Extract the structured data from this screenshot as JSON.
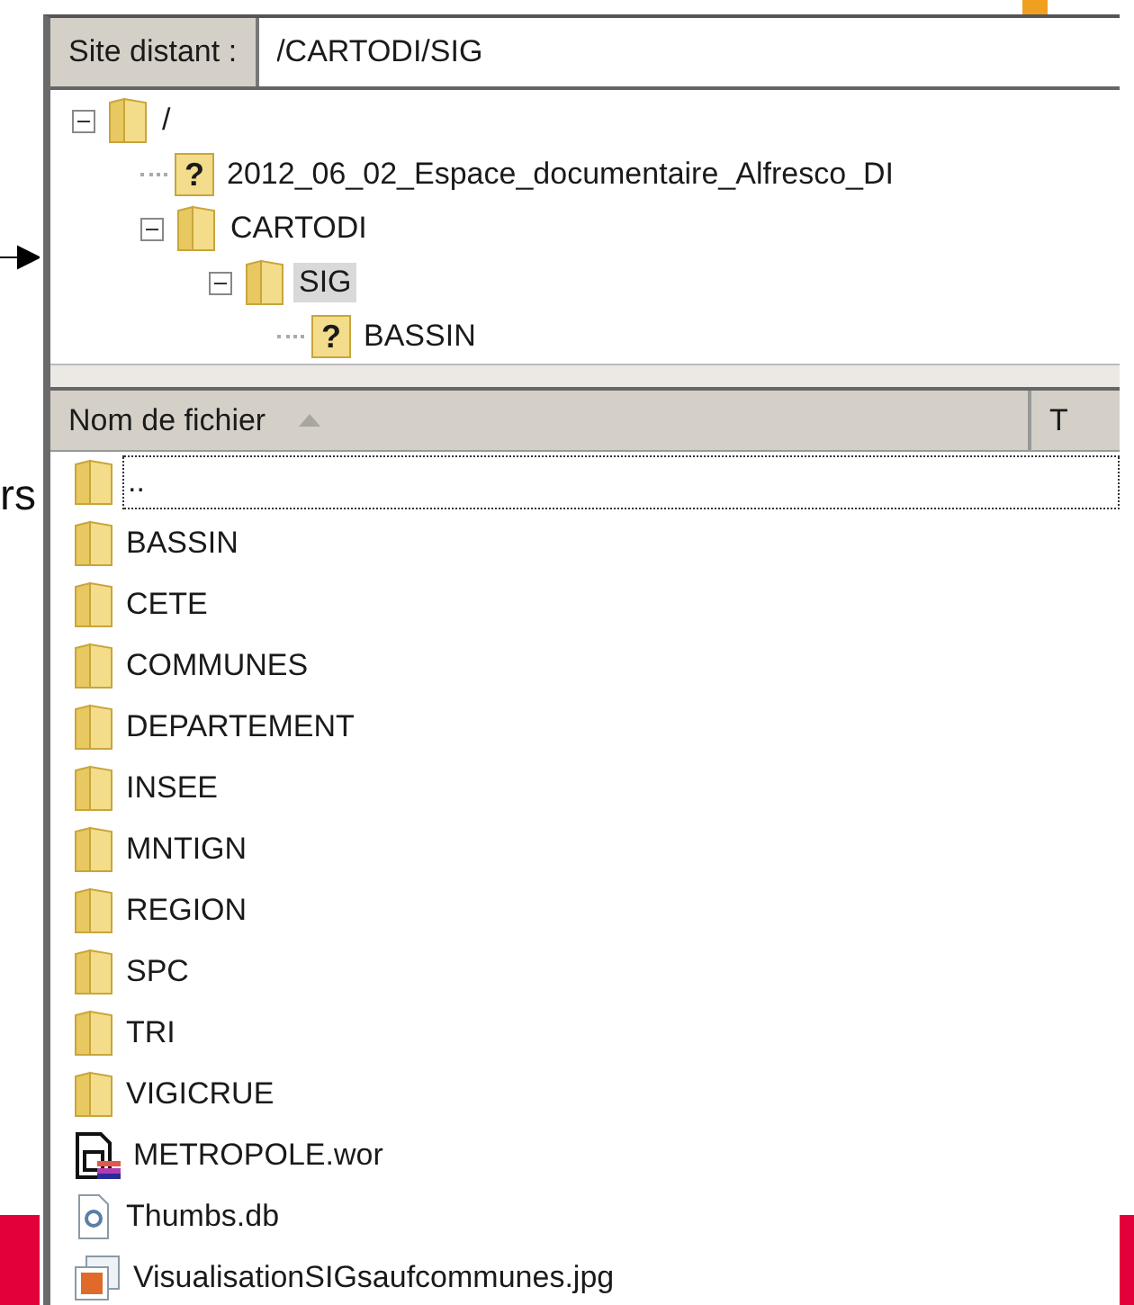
{
  "slide": {
    "side_text": "rs"
  },
  "remote_site": {
    "label": "Site distant :",
    "path": "/CARTODI/SIG"
  },
  "tree": [
    {
      "name": "/",
      "kind": "folder",
      "expanded": true,
      "selected": false,
      "children": [
        {
          "name": "2012_06_02_Espace_documentaire_Alfresco_DI",
          "kind": "unknown",
          "icon_char": "?",
          "selected": false
        },
        {
          "name": "CARTODI",
          "kind": "folder",
          "expanded": true,
          "selected": false,
          "children": [
            {
              "name": "SIG",
              "kind": "folder",
              "expanded": true,
              "selected": true,
              "children": [
                {
                  "name": "BASSIN",
                  "kind": "unknown",
                  "icon_char": "?",
                  "selected": false
                }
              ]
            }
          ]
        }
      ]
    }
  ],
  "file_list": {
    "columns": [
      {
        "label": "Nom de fichier",
        "sort_ascending": true
      },
      {
        "label": "T"
      }
    ],
    "rows": [
      {
        "name": "..",
        "kind": "folder",
        "focused": true
      },
      {
        "name": "BASSIN",
        "kind": "folder",
        "focused": false
      },
      {
        "name": "CETE",
        "kind": "folder",
        "focused": false
      },
      {
        "name": "COMMUNES",
        "kind": "folder",
        "focused": false
      },
      {
        "name": "DEPARTEMENT",
        "kind": "folder",
        "focused": false
      },
      {
        "name": "INSEE",
        "kind": "folder",
        "focused": false
      },
      {
        "name": "MNTIGN",
        "kind": "folder",
        "focused": false
      },
      {
        "name": "REGION",
        "kind": "folder",
        "focused": false
      },
      {
        "name": "SPC",
        "kind": "folder",
        "focused": false
      },
      {
        "name": "TRI",
        "kind": "folder",
        "focused": false
      },
      {
        "name": "VIGICRUE",
        "kind": "folder",
        "focused": false
      },
      {
        "name": "METROPOLE.wor",
        "kind": "workspace",
        "focused": false
      },
      {
        "name": "Thumbs.db",
        "kind": "database",
        "focused": false
      },
      {
        "name": "VisualisationSIGsaufcommunes.jpg",
        "kind": "image",
        "focused": false
      }
    ]
  }
}
